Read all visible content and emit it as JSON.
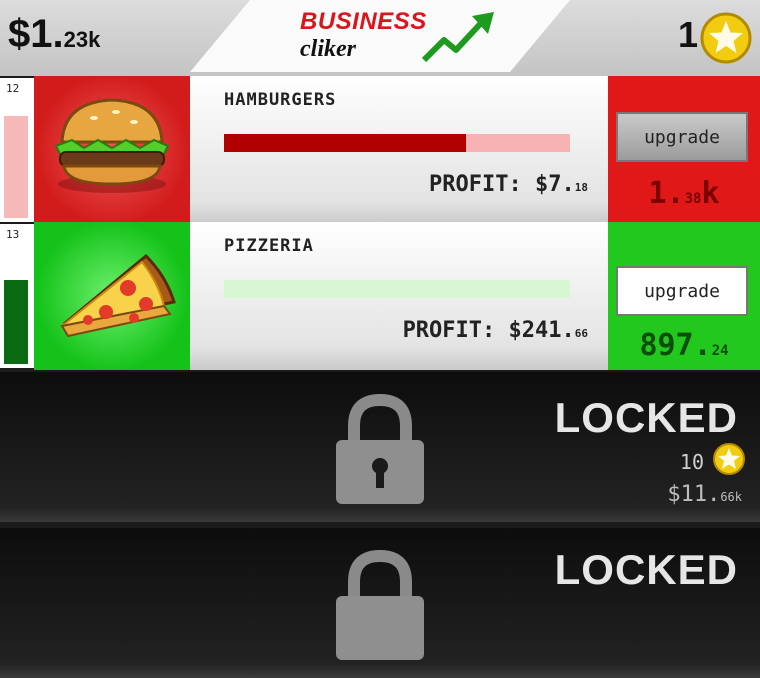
{
  "header": {
    "money_main": "$1.",
    "money_suffix": "23k",
    "logo_line1": "BUSINESS",
    "logo_line2": "cliker",
    "coins": "1",
    "coin_icon": "star-coin-icon"
  },
  "businesses": [
    {
      "level": "12",
      "meter_fraction": 0.85,
      "meter_color": "#f5b9b9",
      "icon": "hamburger-icon",
      "title": "HAMBURGERS",
      "progress": 0.7,
      "progress_fill_color": "#b00000",
      "progress_track_color": "#f7b3b3",
      "profit_main": "PROFIT: $7.",
      "profit_sub": "18",
      "button_label": "upgrade",
      "cost_main": "1.",
      "cost_sub": "38",
      "cost_suffix": "k",
      "cost_color": "#7a0000"
    },
    {
      "level": "13",
      "meter_fraction": 0.7,
      "meter_color": "#0b6b12",
      "icon": "pizza-slice-icon",
      "title": "PIZZERIA",
      "progress": 0.0,
      "progress_fill_color": "#1bb81b",
      "progress_track_color": "#d7f7d3",
      "profit_main": "PROFIT: $241.",
      "profit_sub": "66",
      "button_label": "upgrade",
      "cost_main": "897.",
      "cost_sub": "24",
      "cost_suffix": "",
      "cost_color": "#0c4d0c"
    }
  ],
  "locked": [
    {
      "label": "LOCKED",
      "requirement": "10",
      "price_main": "$11.",
      "price_sub": "66k",
      "icon": "padlock-icon"
    },
    {
      "label": "LOCKED",
      "icon": "padlock-icon"
    }
  ]
}
